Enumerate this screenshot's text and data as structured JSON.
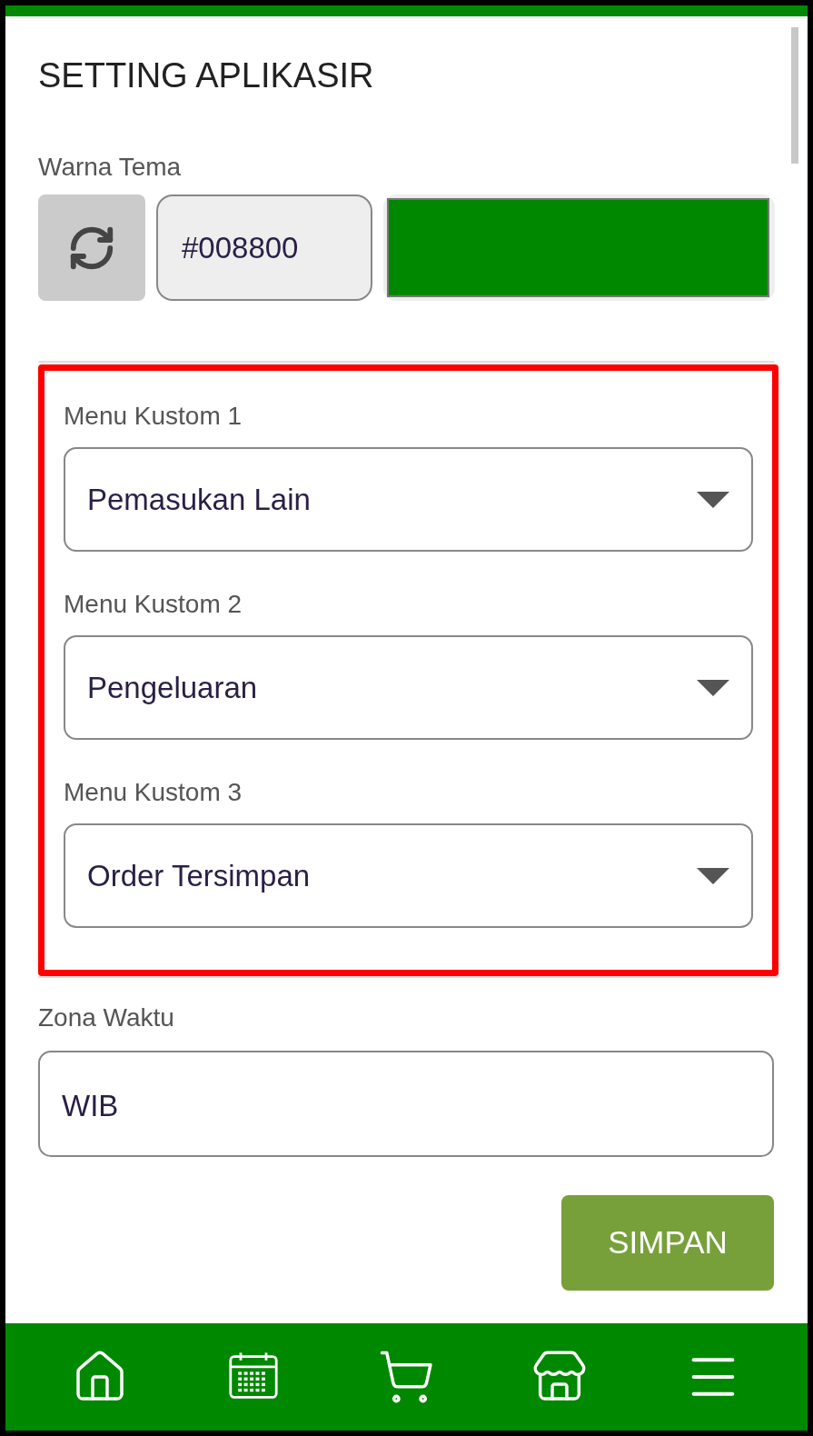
{
  "title": "SETTING APLIKASIR",
  "theme_color": {
    "label": "Warna Tema",
    "value": "#008800"
  },
  "custom_menus": [
    {
      "label": "Menu Kustom 1",
      "value": "Pemasukan Lain"
    },
    {
      "label": "Menu Kustom 2",
      "value": "Pengeluaran"
    },
    {
      "label": "Menu Kustom 3",
      "value": "Order Tersimpan"
    }
  ],
  "timezone": {
    "label": "Zona Waktu",
    "value": "WIB"
  },
  "save_button": "SIMPAN",
  "nav_items": [
    {
      "kind": "home"
    },
    {
      "kind": "calendar"
    },
    {
      "kind": "cart"
    },
    {
      "kind": "store"
    },
    {
      "kind": "menu"
    }
  ]
}
